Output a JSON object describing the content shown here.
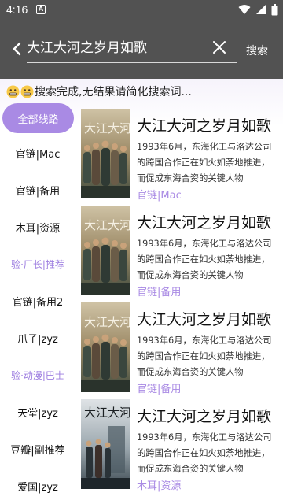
{
  "status_bar": {
    "time": "4:16",
    "notification_glyph": "A"
  },
  "search": {
    "query": "大江大河之岁月如歌",
    "button_label": "搜索"
  },
  "status_message": "搜索完成,无结果请简化搜索词...",
  "sidebar": {
    "items": [
      {
        "label": "全部线路",
        "state": "active"
      },
      {
        "label": "官链|Mac",
        "state": "normal"
      },
      {
        "label": "官链|备用",
        "state": "normal"
      },
      {
        "label": "木耳|资源",
        "state": "normal"
      },
      {
        "label": "验·厂长|推荐",
        "state": "purple"
      },
      {
        "label": "官链|备用2",
        "state": "normal"
      },
      {
        "label": "爪子|zyz",
        "state": "normal"
      },
      {
        "label": "验·动漫|巴士",
        "state": "purple"
      },
      {
        "label": "天堂|zyz",
        "state": "normal"
      },
      {
        "label": "豆瓣|副推荐",
        "state": "normal"
      },
      {
        "label": "爱国|zyz",
        "state": "normal"
      }
    ]
  },
  "results": [
    {
      "title": "大江大河之岁月如歌",
      "description": "1993年6月，东海化工与洛达公司的跨国合作正在如火如荼地推进，而促成东海合资的关键人物",
      "source": "官链|Mac",
      "poster_text": "大江大河",
      "poster": "warm"
    },
    {
      "title": "大江大河之岁月如歌",
      "description": "1993年6月，东海化工与洛达公司的跨国合作正在如火如荼地推进，而促成东海合资的关键人物",
      "source": "官链|备用",
      "poster_text": "大江大河",
      "poster": "warm"
    },
    {
      "title": "大江大河之岁月如歌",
      "description": "1993年6月，东海化工与洛达公司的跨国合作正在如火如荼地推进，而促成东海合资的关键人物",
      "source": "官链|备用",
      "poster_text": "大江大河",
      "poster": "warm"
    },
    {
      "title": "大江大河之岁月如歌",
      "description": "1993年6月，东海化工与洛达公司的跨国合作正在如火如荼地推进，而促成东海合资的关键人物",
      "source": "木耳|资源",
      "poster_text": "大江大河",
      "poster": "cool"
    }
  ],
  "colors": {
    "toolbar": "#525252",
    "accent": "#a98ae4",
    "accent_text": "#9d7de0"
  },
  "icons": [
    "back-arrow-icon",
    "clear-icon",
    "wifi-icon",
    "signal-icon",
    "battery-icon",
    "grimace-emoji-icon"
  ]
}
